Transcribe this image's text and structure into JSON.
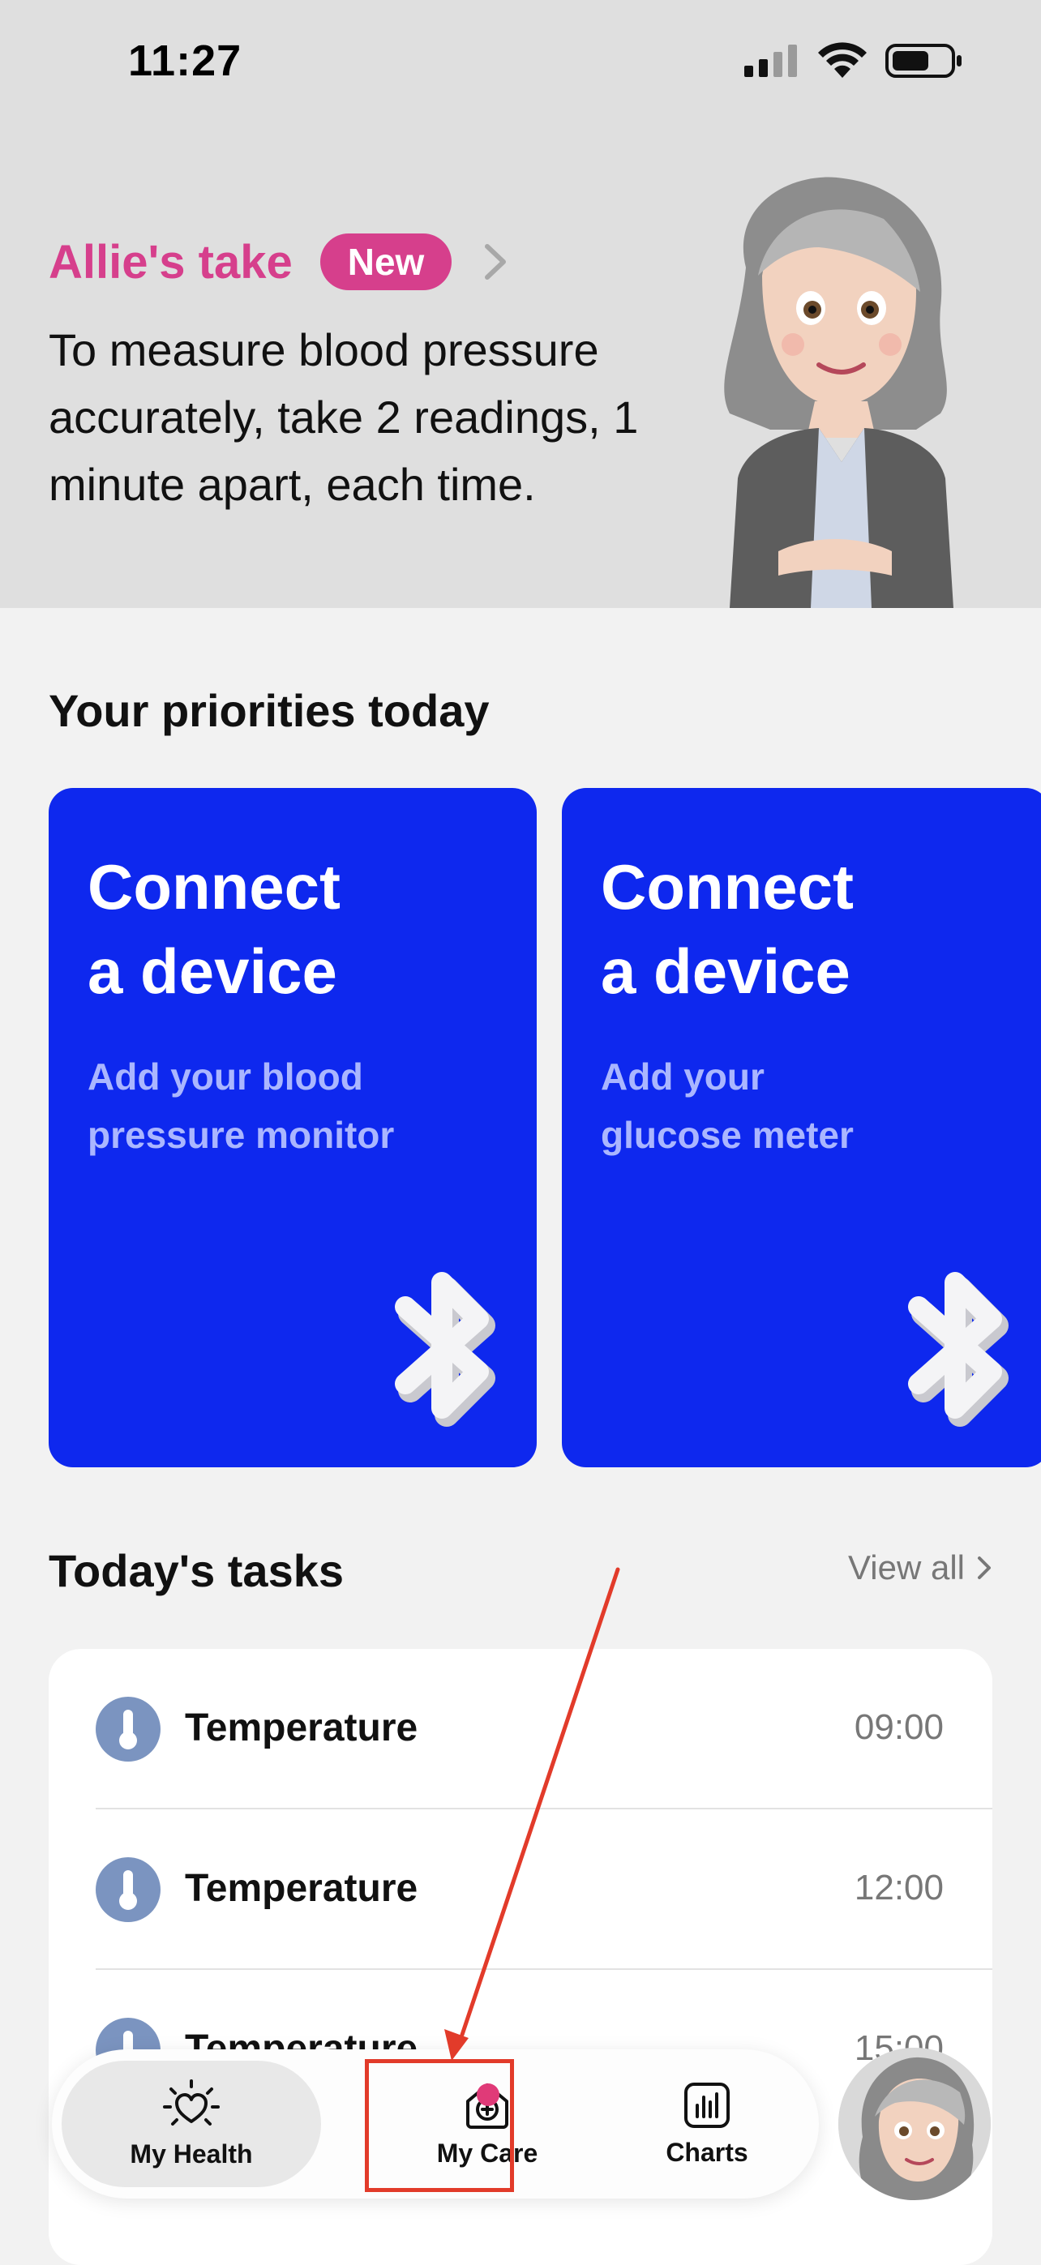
{
  "status": {
    "time": "11:27",
    "icons": [
      "signal-icon",
      "wifi-icon",
      "battery-icon"
    ]
  },
  "hero": {
    "title": "Allie's take",
    "badge": "New",
    "message": "To measure blood pressure accurately, take 2 readings, 1 minute apart, each time."
  },
  "priorities": {
    "section_title": "Your priorities today",
    "cards": [
      {
        "title_line1": "Connect",
        "title_line2": "a device",
        "sub_line1": "Add your blood",
        "sub_line2": "pressure monitor",
        "icon": "bluetooth-icon"
      },
      {
        "title_line1": "Connect",
        "title_line2": "a device",
        "sub_line1": "Add your",
        "sub_line2": "glucose meter",
        "icon": "bluetooth-icon"
      }
    ]
  },
  "tasks": {
    "section_title": "Today's tasks",
    "view_all": "View all",
    "items": [
      {
        "name": "Temperature",
        "time": "09:00",
        "icon": "thermometer-icon"
      },
      {
        "name": "Temperature",
        "time": "12:00",
        "icon": "thermometer-icon"
      },
      {
        "name": "Temperature",
        "time": "15:00",
        "icon": "thermometer-icon"
      }
    ]
  },
  "tab_bar": {
    "tabs": [
      {
        "label": "My Health",
        "icon": "heart-sun-icon",
        "active": true
      },
      {
        "label": "My Care",
        "icon": "home-plus-icon",
        "has_notification": true
      },
      {
        "label": "Charts",
        "icon": "bar-chart-icon"
      }
    ],
    "avatar_icon": "allie-avatar"
  },
  "colors": {
    "accent_pink": "#d63f8c",
    "card_blue": "#0e28ee",
    "annotation_red": "#e23b2a"
  }
}
